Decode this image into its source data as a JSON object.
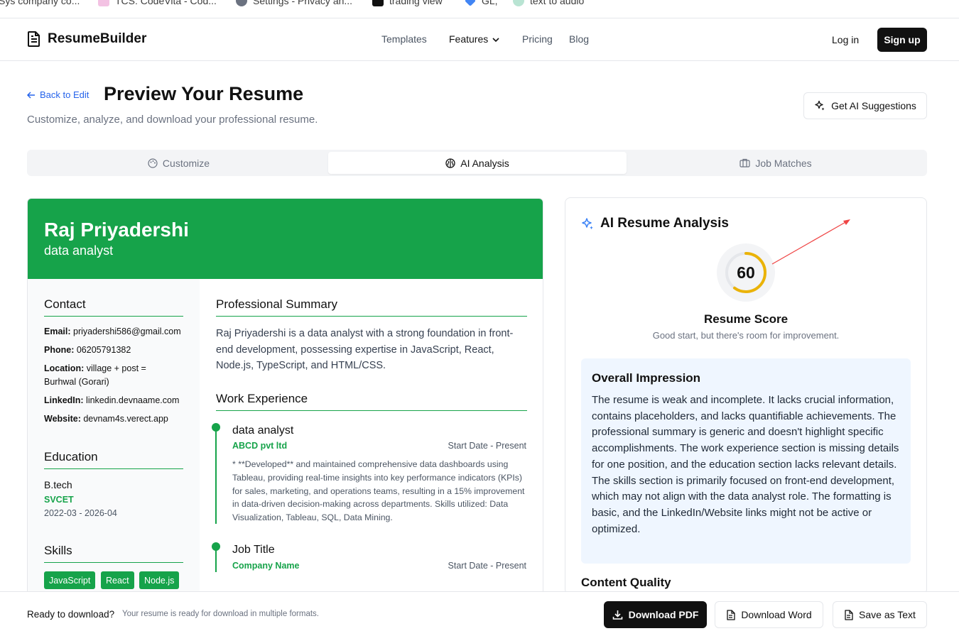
{
  "bookmarks": [
    {
      "label": "Sys company co..."
    },
    {
      "label": "TCS: CodeVita - Cod..."
    },
    {
      "label": "Settings - Privacy an..."
    },
    {
      "label": "trading view"
    },
    {
      "label": "GL,"
    },
    {
      "label": "text to audio"
    }
  ],
  "nav": {
    "brand": "ResumeBuilder",
    "links": [
      "Templates",
      "Features",
      "Pricing",
      "Blog"
    ],
    "login": "Log in",
    "signup": "Sign up"
  },
  "header": {
    "back": "Back to Edit",
    "title": "Preview Your Resume",
    "subtitle": "Customize, analyze, and download your professional resume.",
    "ai_button": "Get AI Suggestions"
  },
  "tabs": [
    "Customize",
    "AI Analysis",
    "Job Matches"
  ],
  "resume": {
    "name": "Raj Priyadershi",
    "role": "data analyst",
    "contact_heading": "Contact",
    "contact": [
      {
        "label": "Email:",
        "value": "priyadershi586@gmail.com"
      },
      {
        "label": "Phone:",
        "value": "06205791382"
      },
      {
        "label": "Location:",
        "value": "village + post = Burhwal (Gorari)"
      },
      {
        "label": "LinkedIn:",
        "value": "linkedin.devnaame.com"
      },
      {
        "label": "Website:",
        "value": "devnam4s.verect.app"
      }
    ],
    "education_heading": "Education",
    "education": {
      "degree": "B.tech",
      "school": "SVCET",
      "dates": "2022-03 - 2026-04"
    },
    "skills_heading": "Skills",
    "skills": [
      "JavaScript",
      "React",
      "Node.js"
    ],
    "summary_heading": "Professional Summary",
    "summary": "Raj Priyadershi is a data analyst with a strong foundation in front-end development, possessing expertise in JavaScript, React, Node.js, TypeScript, and HTML/CSS.",
    "experience_heading": "Work Experience",
    "experience": [
      {
        "title": "data analyst",
        "company": "ABCD pvt ltd",
        "dates": "Start Date - Present",
        "description": "* **Developed** and maintained comprehensive data dashboards using Tableau, providing real-time insights into key performance indicators (KPIs) for sales, marketing, and operations teams, resulting in a 15% improvement in data-driven decision-making across departments. Skills utilized: Data Visualization, Tableau, SQL, Data Mining."
      },
      {
        "title": "Job Title",
        "company": "Company Name",
        "dates": "Start Date - Present",
        "description": ""
      }
    ]
  },
  "analysis": {
    "heading": "AI Resume Analysis",
    "score": "60",
    "score_value": 60,
    "score_title": "Resume Score",
    "score_sub": "Good start, but there's room for improvement.",
    "impression_heading": "Overall Impression",
    "impression": "The resume is weak and incomplete. It lacks crucial information, contains placeholders, and lacks quantifiable achievements. The professional summary is generic and doesn't highlight specific accomplishments. The work experience section is missing details for one position, and the education section lacks relevant details. The skills section is primarily focused on front-end development, which may not align with the data analyst role. The formatting is basic, and the LinkedIn/Website links might not be active or optimized.",
    "content_quality_heading": "Content Quality"
  },
  "footer": {
    "ready": "Ready to download?",
    "ready_sub": "Your resume is ready for download in multiple formats.",
    "pdf": "Download PDF",
    "word": "Download Word",
    "text": "Save as Text"
  },
  "colors": {
    "accent": "#16a34a",
    "score_ring": "#eab308",
    "primary_dark": "#111111",
    "link": "#2563eb"
  }
}
